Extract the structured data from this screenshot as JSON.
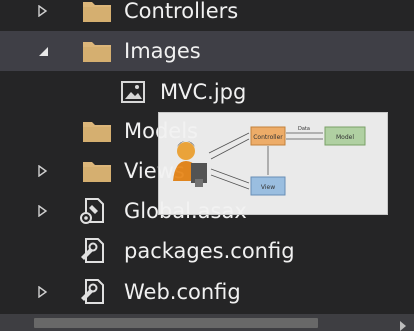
{
  "tree": {
    "items": [
      {
        "label": "Controllers",
        "type": "folder",
        "expanded": false
      },
      {
        "label": "Images",
        "type": "folder",
        "expanded": true,
        "selected": true
      },
      {
        "label": "MVC.jpg",
        "type": "image"
      },
      {
        "label": "Models",
        "type": "folder",
        "expanded": null
      },
      {
        "label": "Views",
        "type": "folder",
        "expanded": false
      },
      {
        "label": "Global.asax",
        "type": "asax",
        "expanded": false
      },
      {
        "label": "packages.config",
        "type": "config"
      },
      {
        "label": "Web.config",
        "type": "config",
        "expanded": false
      }
    ]
  },
  "preview": {
    "controller_label": "Controller",
    "model_label": "Model",
    "view_label": "View",
    "arrow_label_data": "Data"
  },
  "colors": {
    "background": "#252526",
    "selected": "#3f3f46",
    "folder": "#dcb67a",
    "text": "#f1f1f1"
  }
}
